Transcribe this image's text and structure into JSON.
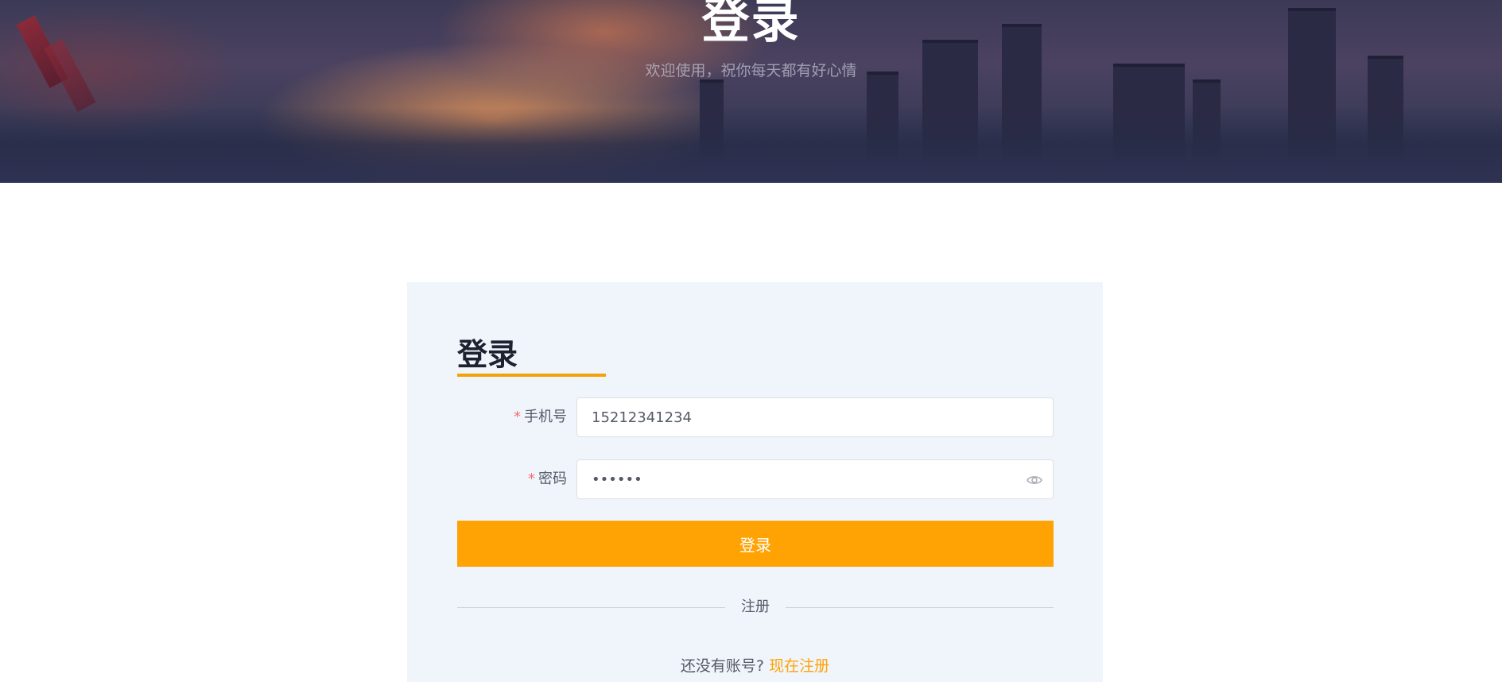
{
  "banner": {
    "title": "登录",
    "subtitle": "欢迎使用，祝你每天都有好心情"
  },
  "login_card": {
    "title": "登录",
    "phone_field": {
      "label": "手机号",
      "required_mark": "*",
      "value": "15212341234"
    },
    "password_field": {
      "label": "密码",
      "required_mark": "*",
      "value": "••••••",
      "toggle_icon": "eye-icon"
    },
    "login_button_label": "登录",
    "divider_text": "注册",
    "register_prompt": "还没有账号?",
    "register_link": "现在注册"
  },
  "colors": {
    "accent": "#ffa305",
    "card_background": "#f0f5fc",
    "required": "#f56c6c"
  }
}
